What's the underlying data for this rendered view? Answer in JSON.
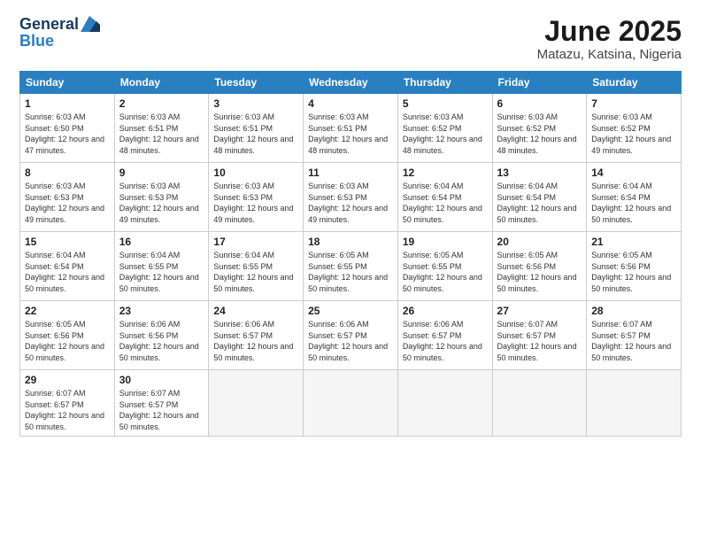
{
  "logo": {
    "general": "General",
    "blue": "Blue"
  },
  "title": "June 2025",
  "subtitle": "Matazu, Katsina, Nigeria",
  "days_of_week": [
    "Sunday",
    "Monday",
    "Tuesday",
    "Wednesday",
    "Thursday",
    "Friday",
    "Saturday"
  ],
  "weeks": [
    [
      {
        "day": 1,
        "sunrise": "6:03 AM",
        "sunset": "6:50 PM",
        "daylight": "12 hours and 47 minutes."
      },
      {
        "day": 2,
        "sunrise": "6:03 AM",
        "sunset": "6:51 PM",
        "daylight": "12 hours and 48 minutes."
      },
      {
        "day": 3,
        "sunrise": "6:03 AM",
        "sunset": "6:51 PM",
        "daylight": "12 hours and 48 minutes."
      },
      {
        "day": 4,
        "sunrise": "6:03 AM",
        "sunset": "6:51 PM",
        "daylight": "12 hours and 48 minutes."
      },
      {
        "day": 5,
        "sunrise": "6:03 AM",
        "sunset": "6:52 PM",
        "daylight": "12 hours and 48 minutes."
      },
      {
        "day": 6,
        "sunrise": "6:03 AM",
        "sunset": "6:52 PM",
        "daylight": "12 hours and 48 minutes."
      },
      {
        "day": 7,
        "sunrise": "6:03 AM",
        "sunset": "6:52 PM",
        "daylight": "12 hours and 49 minutes."
      }
    ],
    [
      {
        "day": 8,
        "sunrise": "6:03 AM",
        "sunset": "6:53 PM",
        "daylight": "12 hours and 49 minutes."
      },
      {
        "day": 9,
        "sunrise": "6:03 AM",
        "sunset": "6:53 PM",
        "daylight": "12 hours and 49 minutes."
      },
      {
        "day": 10,
        "sunrise": "6:03 AM",
        "sunset": "6:53 PM",
        "daylight": "12 hours and 49 minutes."
      },
      {
        "day": 11,
        "sunrise": "6:03 AM",
        "sunset": "6:53 PM",
        "daylight": "12 hours and 49 minutes."
      },
      {
        "day": 12,
        "sunrise": "6:04 AM",
        "sunset": "6:54 PM",
        "daylight": "12 hours and 50 minutes."
      },
      {
        "day": 13,
        "sunrise": "6:04 AM",
        "sunset": "6:54 PM",
        "daylight": "12 hours and 50 minutes."
      },
      {
        "day": 14,
        "sunrise": "6:04 AM",
        "sunset": "6:54 PM",
        "daylight": "12 hours and 50 minutes."
      }
    ],
    [
      {
        "day": 15,
        "sunrise": "6:04 AM",
        "sunset": "6:54 PM",
        "daylight": "12 hours and 50 minutes."
      },
      {
        "day": 16,
        "sunrise": "6:04 AM",
        "sunset": "6:55 PM",
        "daylight": "12 hours and 50 minutes."
      },
      {
        "day": 17,
        "sunrise": "6:04 AM",
        "sunset": "6:55 PM",
        "daylight": "12 hours and 50 minutes."
      },
      {
        "day": 18,
        "sunrise": "6:05 AM",
        "sunset": "6:55 PM",
        "daylight": "12 hours and 50 minutes."
      },
      {
        "day": 19,
        "sunrise": "6:05 AM",
        "sunset": "6:55 PM",
        "daylight": "12 hours and 50 minutes."
      },
      {
        "day": 20,
        "sunrise": "6:05 AM",
        "sunset": "6:56 PM",
        "daylight": "12 hours and 50 minutes."
      },
      {
        "day": 21,
        "sunrise": "6:05 AM",
        "sunset": "6:56 PM",
        "daylight": "12 hours and 50 minutes."
      }
    ],
    [
      {
        "day": 22,
        "sunrise": "6:05 AM",
        "sunset": "6:56 PM",
        "daylight": "12 hours and 50 minutes."
      },
      {
        "day": 23,
        "sunrise": "6:06 AM",
        "sunset": "6:56 PM",
        "daylight": "12 hours and 50 minutes."
      },
      {
        "day": 24,
        "sunrise": "6:06 AM",
        "sunset": "6:57 PM",
        "daylight": "12 hours and 50 minutes."
      },
      {
        "day": 25,
        "sunrise": "6:06 AM",
        "sunset": "6:57 PM",
        "daylight": "12 hours and 50 minutes."
      },
      {
        "day": 26,
        "sunrise": "6:06 AM",
        "sunset": "6:57 PM",
        "daylight": "12 hours and 50 minutes."
      },
      {
        "day": 27,
        "sunrise": "6:07 AM",
        "sunset": "6:57 PM",
        "daylight": "12 hours and 50 minutes."
      },
      {
        "day": 28,
        "sunrise": "6:07 AM",
        "sunset": "6:57 PM",
        "daylight": "12 hours and 50 minutes."
      }
    ],
    [
      {
        "day": 29,
        "sunrise": "6:07 AM",
        "sunset": "6:57 PM",
        "daylight": "12 hours and 50 minutes."
      },
      {
        "day": 30,
        "sunrise": "6:07 AM",
        "sunset": "6:57 PM",
        "daylight": "12 hours and 50 minutes."
      },
      null,
      null,
      null,
      null,
      null
    ]
  ]
}
